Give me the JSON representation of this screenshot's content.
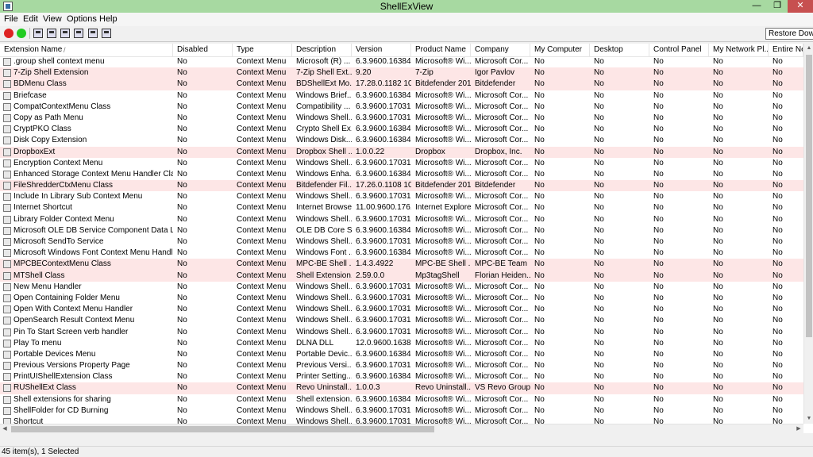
{
  "window": {
    "title": "ShellExView",
    "min_glyph": "—",
    "max_glyph": "❐",
    "close_glyph": "✕"
  },
  "menu": [
    "File",
    "Edit",
    "View",
    "Options",
    "Help"
  ],
  "toolbar": {
    "tooltip": "Restore Down"
  },
  "columns": [
    "Extension Name",
    "Disabled",
    "Type",
    "Description",
    "Version",
    "Product Name",
    "Company",
    "My Computer",
    "Desktop",
    "Control Panel",
    "My Network Pl...",
    "Entire Net"
  ],
  "sort_indicator": "/",
  "rows": [
    {
      "pink": false,
      "icon": "file-icon",
      "cells": [
        ".group shell context menu",
        "No",
        "Context Menu",
        "Microsoft (R) ...",
        "6.3.9600.16384 ...",
        "Microsoft® Wi...",
        "Microsoft Cor...",
        "No",
        "No",
        "No",
        "No",
        "No"
      ]
    },
    {
      "pink": true,
      "icon": "7zip-icon",
      "cells": [
        "7-Zip Shell Extension",
        "No",
        "Context Menu",
        "7-Zip Shell Ext...",
        "9.20",
        "7-Zip",
        "Igor Pavlov",
        "No",
        "No",
        "No",
        "No",
        "No"
      ]
    },
    {
      "pink": true,
      "icon": "bitdefender-icon",
      "cells": [
        "BDMenu Class",
        "No",
        "Context Menu",
        "BDShellExt Mo...",
        "17.28.0.1182 10...",
        "Bitdefender 2014",
        "Bitdefender",
        "No",
        "No",
        "No",
        "No",
        "No"
      ]
    },
    {
      "pink": false,
      "icon": "briefcase-icon",
      "cells": [
        "Briefcase",
        "No",
        "Context Menu",
        "Windows Brief...",
        "6.3.9600.16384 ...",
        "Microsoft® Wi...",
        "Microsoft Cor...",
        "No",
        "No",
        "No",
        "No",
        "No"
      ]
    },
    {
      "pink": false,
      "icon": "window-icon",
      "cells": [
        "CompatContextMenu Class",
        "No",
        "Context Menu",
        "Compatibility ...",
        "6.3.9600.17031 ...",
        "Microsoft® Wi...",
        "Microsoft Cor...",
        "No",
        "No",
        "No",
        "No",
        "No"
      ]
    },
    {
      "pink": false,
      "icon": "window-icon",
      "cells": [
        "Copy as Path Menu",
        "No",
        "Context Menu",
        "Windows Shell...",
        "6.3.9600.17031 ...",
        "Microsoft® Wi...",
        "Microsoft Cor...",
        "No",
        "No",
        "No",
        "No",
        "No"
      ]
    },
    {
      "pink": false,
      "icon": "window-icon",
      "cells": [
        "CryptPKO Class",
        "No",
        "Context Menu",
        "Crypto Shell Ex...",
        "6.3.9600.16384 ...",
        "Microsoft® Wi...",
        "Microsoft Cor...",
        "No",
        "No",
        "No",
        "No",
        "No"
      ]
    },
    {
      "pink": false,
      "icon": "disk-icon",
      "cells": [
        "Disk Copy Extension",
        "No",
        "Context Menu",
        "Windows Disk...",
        "6.3.9600.16384 ...",
        "Microsoft® Wi...",
        "Microsoft Cor...",
        "No",
        "No",
        "No",
        "No",
        "No"
      ]
    },
    {
      "pink": true,
      "icon": "dropbox-icon",
      "cells": [
        "DropboxExt",
        "No",
        "Context Menu",
        "Dropbox Shell ...",
        "1.0.0.22",
        "Dropbox",
        "Dropbox, Inc.",
        "No",
        "No",
        "No",
        "No",
        "No"
      ]
    },
    {
      "pink": false,
      "icon": "window-icon",
      "cells": [
        "Encryption Context Menu",
        "No",
        "Context Menu",
        "Windows Shell...",
        "6.3.9600.17031 ...",
        "Microsoft® Wi...",
        "Microsoft Cor...",
        "No",
        "No",
        "No",
        "No",
        "No"
      ]
    },
    {
      "pink": false,
      "icon": "drive-icon",
      "cells": [
        "Enhanced Storage Context Menu Handler Class",
        "No",
        "Context Menu",
        "Windows Enha...",
        "6.3.9600.16384 ...",
        "Microsoft® Wi...",
        "Microsoft Cor...",
        "No",
        "No",
        "No",
        "No",
        "No"
      ]
    },
    {
      "pink": true,
      "icon": "window-icon",
      "cells": [
        "FileShredderCtxMenu Class",
        "No",
        "Context Menu",
        "Bitdefender Fil...",
        "17.26.0.1108 10...",
        "Bitdefender 2014",
        "Bitdefender",
        "No",
        "No",
        "No",
        "No",
        "No"
      ]
    },
    {
      "pink": false,
      "icon": "library-icon",
      "cells": [
        "Include In Library Sub Context Menu",
        "No",
        "Context Menu",
        "Windows Shell...",
        "6.3.9600.17031 ...",
        "Microsoft® Wi...",
        "Microsoft Cor...",
        "No",
        "No",
        "No",
        "No",
        "No"
      ]
    },
    {
      "pink": false,
      "icon": "globe-icon",
      "cells": [
        "Internet Shortcut",
        "No",
        "Context Menu",
        "Internet Browser",
        "11.00.9600.176...",
        "Internet Explorer",
        "Microsoft Cor...",
        "No",
        "No",
        "No",
        "No",
        "No"
      ]
    },
    {
      "pink": false,
      "icon": "window-icon",
      "cells": [
        "Library Folder Context Menu",
        "No",
        "Context Menu",
        "Windows Shell...",
        "6.3.9600.17031 ...",
        "Microsoft® Wi...",
        "Microsoft Cor...",
        "No",
        "No",
        "No",
        "No",
        "No"
      ]
    },
    {
      "pink": false,
      "icon": "window-icon",
      "cells": [
        "Microsoft OLE DB Service Component Data Links",
        "No",
        "Context Menu",
        "OLE DB Core S...",
        "6.3.9600.16384 ...",
        "Microsoft® Wi...",
        "Microsoft Cor...",
        "No",
        "No",
        "No",
        "No",
        "No"
      ]
    },
    {
      "pink": false,
      "icon": "window-icon",
      "cells": [
        "Microsoft SendTo Service",
        "No",
        "Context Menu",
        "Windows Shell...",
        "6.3.9600.17031 ...",
        "Microsoft® Wi...",
        "Microsoft Cor...",
        "No",
        "No",
        "No",
        "No",
        "No"
      ]
    },
    {
      "pink": false,
      "icon": "font-icon",
      "cells": [
        "Microsoft Windows Font Context Menu Handler",
        "No",
        "Context Menu",
        "Windows Font ...",
        "6.3.9600.16384 ...",
        "Microsoft® Wi...",
        "Microsoft Cor...",
        "No",
        "No",
        "No",
        "No",
        "No"
      ]
    },
    {
      "pink": true,
      "icon": "folder-icon",
      "cells": [
        "MPCBEContextMenu Class",
        "No",
        "Context Menu",
        "MPC-BE Shell ...",
        "1.4.3.4922",
        "MPC-BE Shell ...",
        "MPC-BE Team",
        "No",
        "No",
        "No",
        "No",
        "No"
      ]
    },
    {
      "pink": true,
      "icon": "check-icon",
      "cells": [
        "MTShell Class",
        "No",
        "Context Menu",
        "Shell Extension...",
        "2.59.0.0",
        "Mp3tagShell",
        "Florian Heiden...",
        "No",
        "No",
        "No",
        "No",
        "No"
      ]
    },
    {
      "pink": false,
      "icon": "window-icon",
      "cells": [
        "New Menu Handler",
        "No",
        "Context Menu",
        "Windows Shell...",
        "6.3.9600.17031 ...",
        "Microsoft® Wi...",
        "Microsoft Cor...",
        "No",
        "No",
        "No",
        "No",
        "No"
      ]
    },
    {
      "pink": false,
      "icon": "window-icon",
      "cells": [
        "Open Containing Folder Menu",
        "No",
        "Context Menu",
        "Windows Shell...",
        "6.3.9600.17031 ...",
        "Microsoft® Wi...",
        "Microsoft Cor...",
        "No",
        "No",
        "No",
        "No",
        "No"
      ]
    },
    {
      "pink": false,
      "icon": "window-icon",
      "cells": [
        "Open With Context Menu Handler",
        "No",
        "Context Menu",
        "Windows Shell...",
        "6.3.9600.17031 ...",
        "Microsoft® Wi...",
        "Microsoft Cor...",
        "No",
        "No",
        "No",
        "No",
        "No"
      ]
    },
    {
      "pink": false,
      "icon": "window-icon",
      "cells": [
        "OpenSearch Result Context Menu",
        "No",
        "Context Menu",
        "Windows Shell...",
        "6.3.9600.17031 ...",
        "Microsoft® Wi...",
        "Microsoft Cor...",
        "No",
        "No",
        "No",
        "No",
        "No"
      ]
    },
    {
      "pink": false,
      "icon": "window-icon",
      "cells": [
        "Pin To Start Screen verb handler",
        "No",
        "Context Menu",
        "Windows Shell...",
        "6.3.9600.17031 ...",
        "Microsoft® Wi...",
        "Microsoft Cor...",
        "No",
        "No",
        "No",
        "No",
        "No"
      ]
    },
    {
      "pink": false,
      "icon": "play-icon",
      "cells": [
        "Play To menu",
        "No",
        "Context Menu",
        "DLNA DLL",
        "12.0.9600.1638...",
        "Microsoft® Wi...",
        "Microsoft Cor...",
        "No",
        "No",
        "No",
        "No",
        "No"
      ]
    },
    {
      "pink": false,
      "icon": "device-icon",
      "cells": [
        "Portable Devices Menu",
        "No",
        "Context Menu",
        "Portable Devic...",
        "6.3.9600.16384 ...",
        "Microsoft® Wi...",
        "Microsoft Cor...",
        "No",
        "No",
        "No",
        "No",
        "No"
      ]
    },
    {
      "pink": false,
      "icon": "window-icon",
      "cells": [
        "Previous Versions Property Page",
        "No",
        "Context Menu",
        "Previous Versi...",
        "6.3.9600.17031 ...",
        "Microsoft® Wi...",
        "Microsoft Cor...",
        "No",
        "No",
        "No",
        "No",
        "No"
      ]
    },
    {
      "pink": false,
      "icon": "printer-icon",
      "cells": [
        "PrintUIShellExtension Class",
        "No",
        "Context Menu",
        "Printer Setting...",
        "6.3.9600.16384 ...",
        "Microsoft® Wi...",
        "Microsoft Cor...",
        "No",
        "No",
        "No",
        "No",
        "No"
      ]
    },
    {
      "pink": true,
      "icon": "window-icon",
      "cells": [
        "RUShellExt Class",
        "No",
        "Context Menu",
        "Revo Uninstall...",
        "1.0.0.3",
        "Revo Uninstall...",
        "VS Revo Group",
        "No",
        "No",
        "No",
        "No",
        "No"
      ]
    },
    {
      "pink": false,
      "icon": "share-icon",
      "cells": [
        "Shell extensions for sharing",
        "No",
        "Context Menu",
        "Shell extension...",
        "6.3.9600.16384 ...",
        "Microsoft® Wi...",
        "Microsoft Cor...",
        "No",
        "No",
        "No",
        "No",
        "No"
      ]
    },
    {
      "pink": false,
      "icon": "cd-icon",
      "cells": [
        "ShellFolder for CD Burning",
        "No",
        "Context Menu",
        "Windows Shell...",
        "6.3.9600.17031 ...",
        "Microsoft® Wi...",
        "Microsoft Cor...",
        "No",
        "No",
        "No",
        "No",
        "No"
      ]
    },
    {
      "pink": false,
      "icon": "window-icon",
      "cells": [
        "Shortcut",
        "No",
        "Context Menu",
        "Windows Shell...",
        "6.3.9600.17031 ...",
        "Microsoft® Wi...",
        "Microsoft Cor...",
        "No",
        "No",
        "No",
        "No",
        "No"
      ]
    }
  ],
  "status": {
    "text": "45 item(s), 1 Selected"
  }
}
